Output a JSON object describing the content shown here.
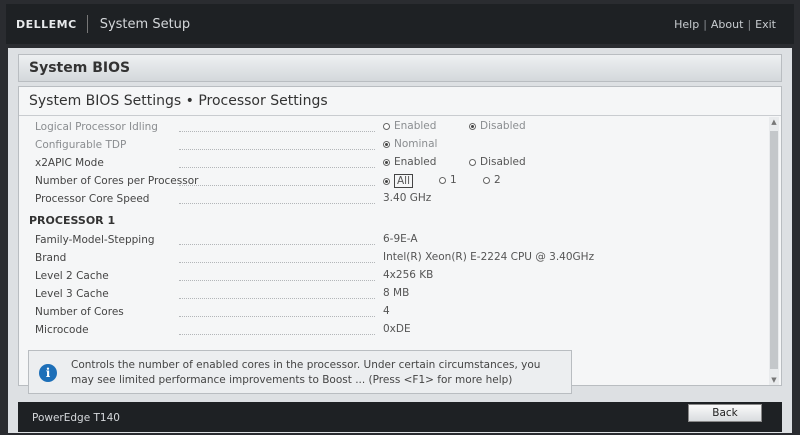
{
  "topbar": {
    "brand": "DELLEMC",
    "app_title": "System Setup",
    "links": {
      "help": "Help",
      "about": "About",
      "exit": "Exit",
      "separator": "|"
    }
  },
  "section": {
    "title": "System BIOS"
  },
  "settings": {
    "title": "System BIOS Settings • Processor Settings",
    "rows": [
      {
        "label": "Logical Processor Idling",
        "options": [
          {
            "label": "Enabled",
            "selected": false
          },
          {
            "label": "Disabled",
            "selected": true
          }
        ]
      },
      {
        "label": "Configurable TDP",
        "options": [
          {
            "label": "Nominal",
            "selected": true
          }
        ]
      },
      {
        "label": "x2APIC Mode",
        "options": [
          {
            "label": "Enabled",
            "selected": true
          },
          {
            "label": "Disabled",
            "selected": false
          }
        ]
      },
      {
        "label": "Number of Cores per Processor",
        "options": [
          {
            "label": "All",
            "selected": true
          },
          {
            "label": "1",
            "selected": false
          },
          {
            "label": "2",
            "selected": false
          }
        ]
      },
      {
        "label": "Processor Core Speed",
        "value": "3.40 GHz"
      }
    ],
    "processor_heading": "PROCESSOR 1",
    "processor_rows": [
      {
        "label": "Family-Model-Stepping",
        "value": "6-9E-A"
      },
      {
        "label": "Brand",
        "value": "Intel(R) Xeon(R) E-2224 CPU @ 3.40GHz"
      },
      {
        "label": "Level 2 Cache",
        "value": "4x256 KB"
      },
      {
        "label": "Level 3 Cache",
        "value": "8 MB"
      },
      {
        "label": "Number of Cores",
        "value": "4"
      },
      {
        "label": "Microcode",
        "value": "0xDE"
      }
    ]
  },
  "help": {
    "line1": "Controls the number of enabled cores in the processor. Under certain circumstances, you",
    "line2": "may see limited performance improvements to Boost ... (Press <F1> for more help)"
  },
  "footer": {
    "model": "PowerEdge T140",
    "back_label": "Back"
  },
  "colors": {
    "info_icon": "#1d6fb8",
    "topbar_bg": "#1e2124",
    "panel_bg": "#dde0e3"
  }
}
